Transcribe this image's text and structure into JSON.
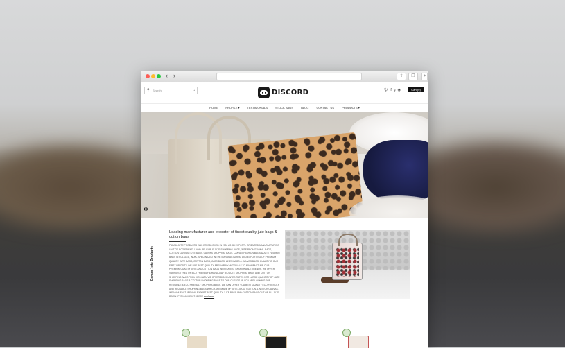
{
  "browser": {
    "back_icon": "chevron-left-icon",
    "forward_icon": "chevron-right-icon"
  },
  "header": {
    "search_placeholder": "Search",
    "logo_text": "DISCORD",
    "cart_label": "Cart (0)"
  },
  "nav": {
    "items": [
      "HOME",
      "PROFILE ▾",
      "TESTIMONIALS",
      "STOCK BAGS",
      "BLOG",
      "CONTACT US",
      "PRODUCTS ▾"
    ]
  },
  "about": {
    "side_label": "Param Jute Products",
    "headline": "Leading manufacturer and exporter of finest quality jute bags & cotton bags",
    "paragraph": "Param Jute Products was established in 2006 as an export - oriented manufacturing unit of eco friendly and reusable jute shopping bags, jute promotional bags, cotton canvas tote bags, canvas shopping bags, canvas fashion bags & jute fashion bags in Kolkata, India. Specialized in the manufacturing and exporting of premium quality jute bags, cotton bags, juco bags, linen bags & canvas bags. Quality is our first priority. We use best quality fresh raw materials to manufacture our premium quality jute and cotton bags with latest fashionable trends. We offer various types of eco friendly & handcrafted jute shopping bags and cotton shopping bags from Kolkata. We offer discounted rates for large quantity of jute shopping bags & cotton shopping bags to our clients. If you are looking for reusable & eco friendly shopping bags, we can offer you best quality eco friendly and reusable shopping bags which are made of jute, juco, cotton, linen or canvas. We manufacture and export best quality jute bags and cotton bags out of all jute products manufacturers",
    "read_more": "read more"
  }
}
